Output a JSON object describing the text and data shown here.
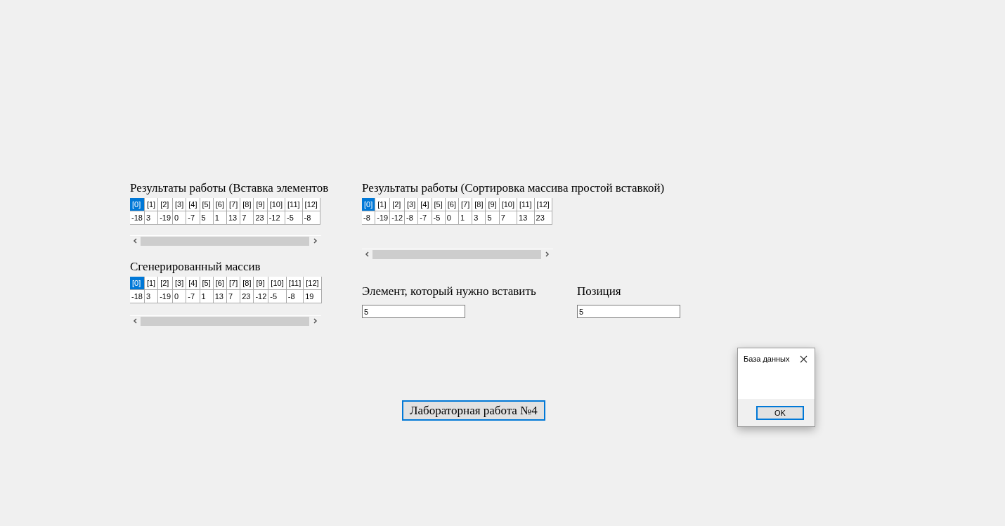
{
  "insert_results": {
    "title": "Результаты работы (Вставка элементов",
    "columns": [
      {
        "label": "[0]",
        "selected": true
      },
      {
        "label": "[1]",
        "selected": false
      },
      {
        "label": "[2]",
        "selected": false
      },
      {
        "label": "[3]",
        "selected": false
      },
      {
        "label": "[4]",
        "selected": false
      },
      {
        "label": "[5]",
        "selected": false
      },
      {
        "label": "[6]",
        "selected": false
      },
      {
        "label": "[7]",
        "selected": false
      },
      {
        "label": "[8]",
        "selected": false
      },
      {
        "label": "[9]",
        "selected": false
      },
      {
        "label": "[10]",
        "selected": false
      },
      {
        "label": "[11]",
        "selected": false
      },
      {
        "label": "[12]",
        "selected": false
      }
    ],
    "values": [
      "-18",
      "3",
      "-19",
      "0",
      "-7",
      "5",
      "1",
      "13",
      "7",
      "23",
      "-12",
      "-5",
      "-8"
    ]
  },
  "generated_array": {
    "title": "Сгенерированный массив",
    "columns": [
      {
        "label": "[0]",
        "selected": true
      },
      {
        "label": "[1]",
        "selected": false
      },
      {
        "label": "[2]",
        "selected": false
      },
      {
        "label": "[3]",
        "selected": false
      },
      {
        "label": "[4]",
        "selected": false
      },
      {
        "label": "[5]",
        "selected": false
      },
      {
        "label": "[6]",
        "selected": false
      },
      {
        "label": "[7]",
        "selected": false
      },
      {
        "label": "[8]",
        "selected": false
      },
      {
        "label": "[9]",
        "selected": false
      },
      {
        "label": "[10]",
        "selected": false
      },
      {
        "label": "[11]",
        "selected": false
      },
      {
        "label": "[12]",
        "selected": false
      }
    ],
    "values": [
      "-18",
      "3",
      "-19",
      "0",
      "-7",
      "1",
      "13",
      "7",
      "23",
      "-12",
      "-5",
      "-8",
      "19"
    ]
  },
  "sort_results": {
    "title": "Результаты работы (Сортировка массива простой вставкой)",
    "columns": [
      {
        "label": "[0]",
        "selected": true
      },
      {
        "label": "[1]",
        "selected": false
      },
      {
        "label": "[2]",
        "selected": false
      },
      {
        "label": "[3]",
        "selected": false
      },
      {
        "label": "[4]",
        "selected": false
      },
      {
        "label": "[5]",
        "selected": false
      },
      {
        "label": "[6]",
        "selected": false
      },
      {
        "label": "[7]",
        "selected": false
      },
      {
        "label": "[8]",
        "selected": false
      },
      {
        "label": "[9]",
        "selected": false
      },
      {
        "label": "[10]",
        "selected": false
      },
      {
        "label": "[11]",
        "selected": false
      },
      {
        "label": "[12]",
        "selected": false
      }
    ],
    "values": [
      "-8",
      "-19",
      "-12",
      "-8",
      "-7",
      "-5",
      "0",
      "1",
      "3",
      "5",
      "7",
      "13",
      "23"
    ]
  },
  "element_field": {
    "label": "Элемент, который нужно вставить",
    "value": "5"
  },
  "position_field": {
    "label": "Позиция",
    "value": "5"
  },
  "lab_button": "Лабораторная работа №4",
  "dialog": {
    "title": "База данных",
    "ok_button": "OK"
  }
}
